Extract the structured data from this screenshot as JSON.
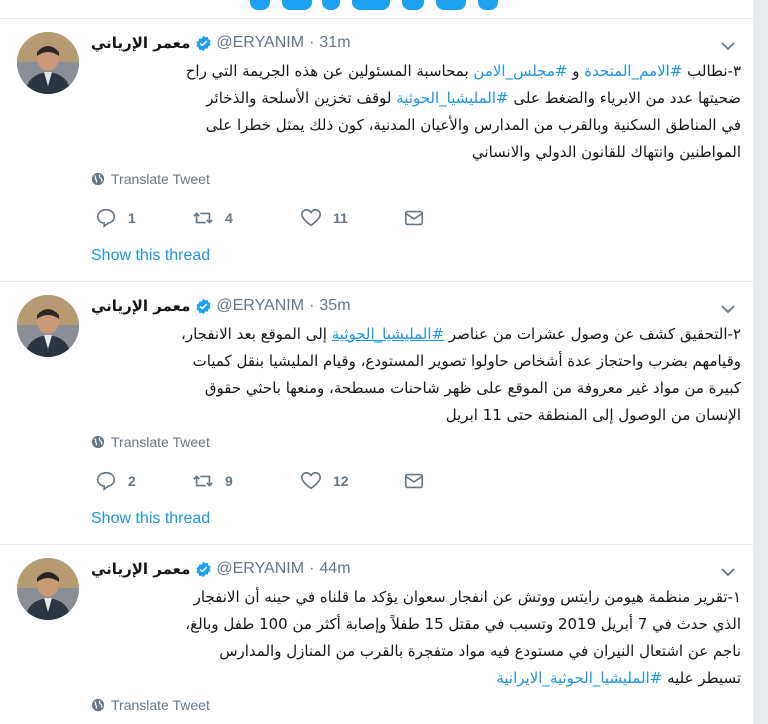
{
  "colors": {
    "accent": "#1da1f2",
    "link": "#1b95e0",
    "muted": "#657786",
    "text": "#14171a",
    "divider": "#e6ecf0"
  },
  "tweets": [
    {
      "author": {
        "name": "معمر الإرياني",
        "handle": "@ERYANIM",
        "verified": true
      },
      "time": "31m",
      "body": {
        "line1": {
          "before": "٣-نطالب ",
          "hashtag1": "#الامم_المتحدة",
          "middle": " و ",
          "hashtag2": "#مجلس_الامن",
          "after": " بمحاسبة المسئولين عن هذه الجريمة التي راح"
        },
        "line2": {
          "before": "ضحيتها عدد من الابرياء والضغط على ",
          "hashtag": "#المليشيا_الحوثية",
          "after": " لوقف تخزين الأسلحة والذخائر"
        },
        "line3": "في المناطق السكنية وبالقرب من المدارس والأعيان المدنية، كون ذلك يمثل خطرا على",
        "line4": "المواطنين وانتهاك للقانون الدولي والانساني"
      },
      "translate_label": "Translate Tweet",
      "replies": "1",
      "retweets": "4",
      "likes": "11",
      "show_thread": "Show this thread"
    },
    {
      "author": {
        "name": "معمر الإرياني",
        "handle": "@ERYANIM",
        "verified": true
      },
      "time": "35m",
      "body": {
        "line1": {
          "before": "٢-التحقيق كشف عن وصول عشرات من عناصر ",
          "hashtag": "#المليشيا_الحوثية",
          "after": " إلى الموقع بعد الانفجار،"
        },
        "line2": "وقيامهم بضرب واحتجاز عدة أشخاص حاولوا تصوير المستودع، وقيام المليشيا بنقل كميات",
        "line3": "كبيرة من مواد غير معروفة من الموقع على ظهر شاحنات مسطحة، ومنعها باحثي حقوق",
        "line4": "الإنسان من الوصول إلى المنطقة حتى 11 ابريل"
      },
      "translate_label": "Translate Tweet",
      "replies": "2",
      "retweets": "9",
      "likes": "12",
      "show_thread": "Show this thread"
    },
    {
      "author": {
        "name": "معمر الإرياني",
        "handle": "@ERYANIM",
        "verified": true
      },
      "time": "44m",
      "body": {
        "line1": "١-تقرير منظمة هيومن رايتس ووتش عن انفجار سعوان يؤكد ما قلناه في حينه أن الانفجار",
        "line2": "الذي حدث في 7 أبريل 2019 وتسبب في مقتل 15 طفلاً وإصابة أكثر من 100 طفل وبالغ،",
        "line3": "ناجم عن اشتعال النيران في مستودع فيه مواد متفجرة بالقرب من المنازل والمدارس",
        "line4": {
          "before": "تسيطر عليه ",
          "hashtag": "#المليشيا_الحوثية_الايرانية"
        }
      },
      "translate_label": "Translate Tweet"
    }
  ]
}
